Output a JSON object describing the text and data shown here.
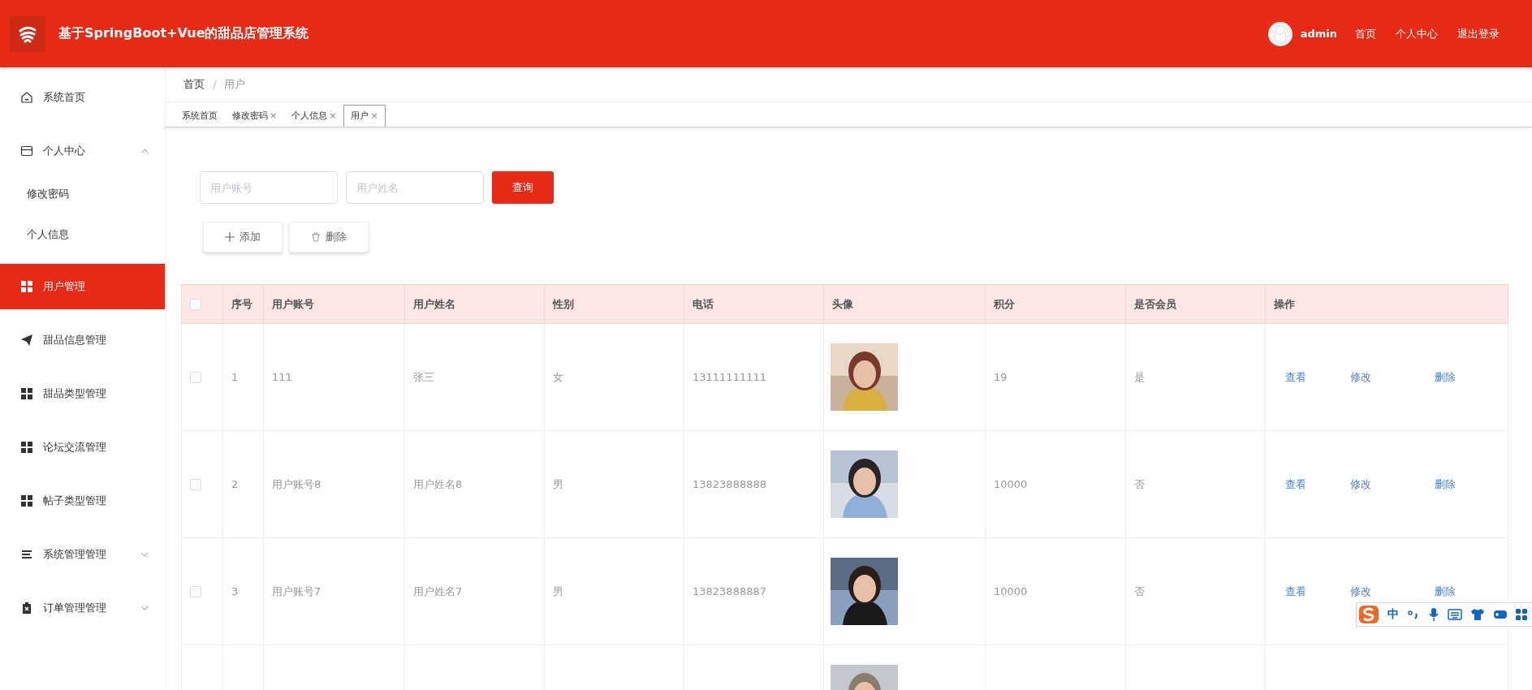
{
  "header": {
    "title": "基于SpringBoot+Vue的甜品店管理系统",
    "user": "admin",
    "links": [
      "首页",
      "个人中心",
      "退出登录"
    ]
  },
  "sidebar": {
    "items": [
      {
        "label": "系统首页",
        "selected": false
      },
      {
        "label": "个人中心",
        "selected": false,
        "expanded": true,
        "children": [
          {
            "label": "修改密码",
            "selected": false
          },
          {
            "label": "个人信息",
            "selected": false
          }
        ]
      },
      {
        "label": "用户管理",
        "selected": true
      },
      {
        "label": "甜品信息管理",
        "selected": false
      },
      {
        "label": "甜品类型管理",
        "selected": false
      },
      {
        "label": "论坛交流管理",
        "selected": false
      },
      {
        "label": "帖子类型管理",
        "selected": false
      },
      {
        "label": "系统管理管理",
        "selected": false,
        "expanded": false
      },
      {
        "label": "订单管理管理",
        "selected": false,
        "expanded": false
      }
    ]
  },
  "breadcrumb": {
    "separator": "/",
    "items": [
      "首页",
      "用户"
    ]
  },
  "tabs": [
    {
      "label": "系统首页",
      "selected": false
    },
    {
      "label": "修改密码",
      "close": "×",
      "selected": false
    },
    {
      "label": "个人信息",
      "close": "×",
      "selected": false
    },
    {
      "label": "用户",
      "close": "×",
      "selected": true
    }
  ],
  "search": {
    "fields": [
      {
        "placeholder": "用户账号"
      },
      {
        "placeholder": "用户姓名"
      }
    ],
    "button": "查询"
  },
  "actions": [
    {
      "label": "添加",
      "kind": "add"
    },
    {
      "label": "删除",
      "kind": "delete"
    }
  ],
  "table": {
    "select_all": {
      "checked": false
    },
    "columns": [
      "序号",
      "用户账号",
      "用户姓名",
      "性别",
      "电话",
      "头像",
      "积分",
      "是否会员",
      "操作"
    ],
    "rows": [
      {
        "checked": false,
        "index": "1",
        "account": "111",
        "name": "张三",
        "gender": "女",
        "phone": "13111111111",
        "avatar": {
          "kind": "picture"
        },
        "points": "19",
        "member": "是",
        "actions": [
          "查看",
          "修改",
          "删除"
        ]
      },
      {
        "checked": false,
        "index": "2",
        "account": "用户账号8",
        "name": "用户姓名8",
        "gender": "男",
        "phone": "13823888888",
        "avatar": {
          "kind": "picture"
        },
        "points": "10000",
        "member": "否",
        "actions": [
          "查看",
          "修改",
          "删除"
        ]
      },
      {
        "checked": false,
        "index": "3",
        "account": "用户账号7",
        "name": "用户姓名7",
        "gender": "男",
        "phone": "13823888887",
        "avatar": {
          "kind": "picture"
        },
        "points": "10000",
        "member": "否",
        "actions": [
          "查看",
          "修改",
          "删除"
        ]
      },
      {
        "avatar": {
          "kind": "picture"
        }
      }
    ]
  },
  "ime_bar": {
    "label": "中"
  }
}
